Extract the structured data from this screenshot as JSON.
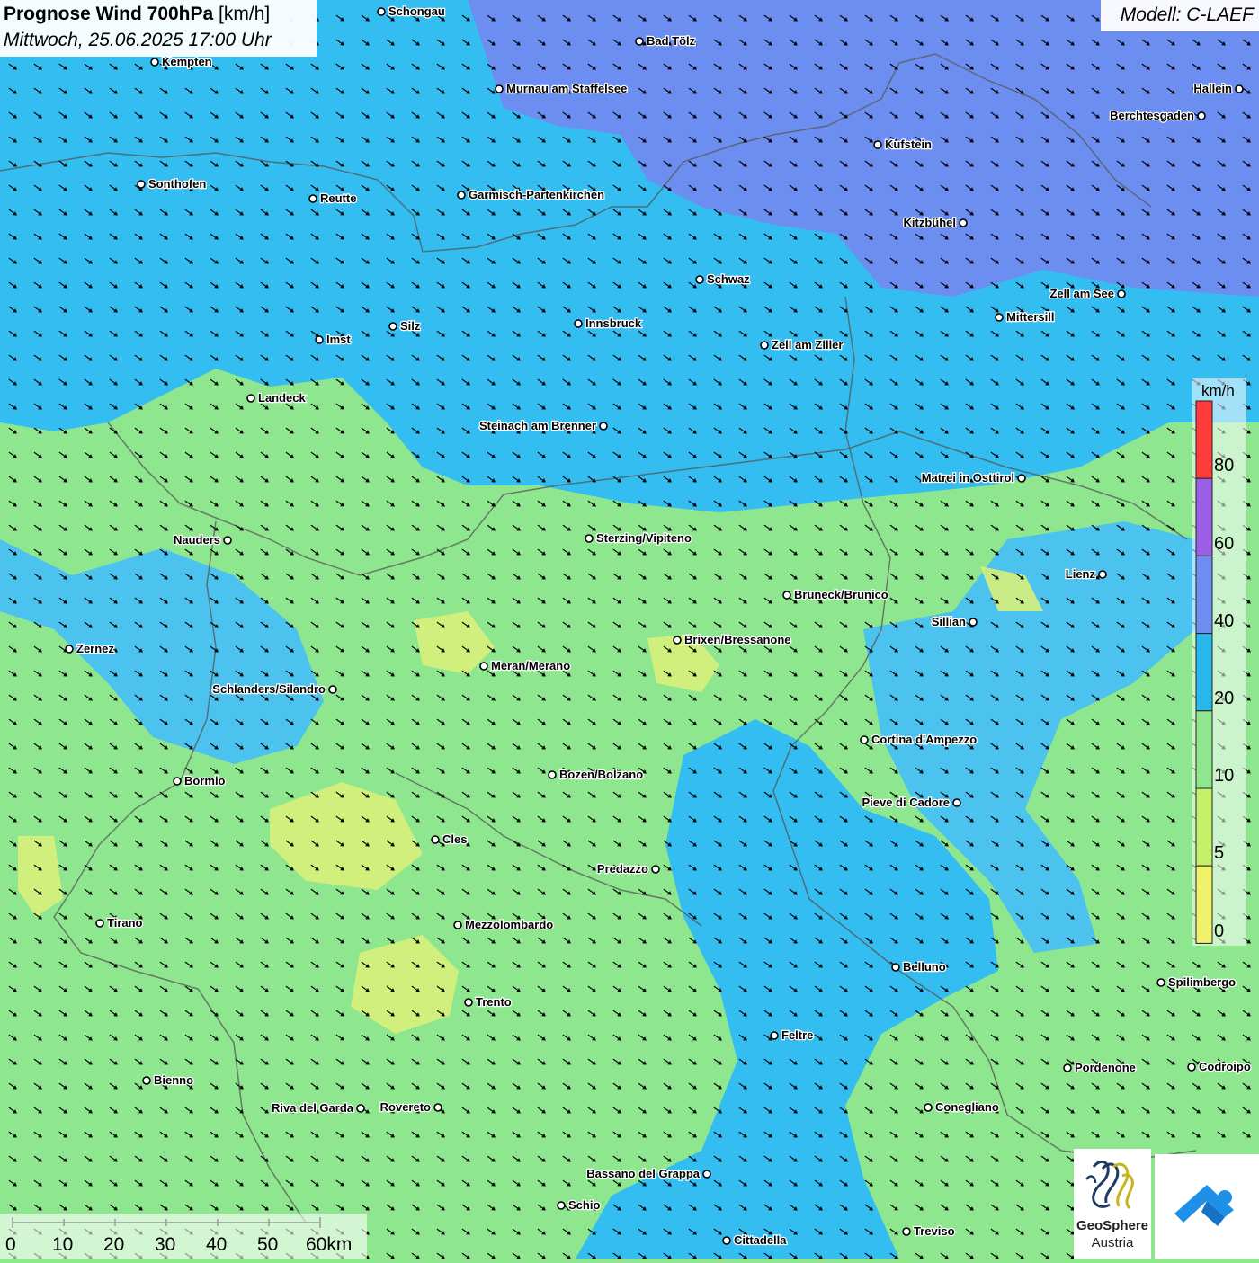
{
  "title": {
    "main": "Prognose Wind 700hPa",
    "unit": "[km/h]",
    "datetime": "Mittwoch, 25.06.2025 17:00 Uhr"
  },
  "model": "Modell: C-LAEF",
  "legend": {
    "unit": "km/h",
    "labels": [
      "80",
      "60",
      "40",
      "20",
      "10",
      "5",
      "0"
    ],
    "colors": [
      "#ff3b3b",
      "#9d5ee6",
      "#6f8cf0",
      "#29b8ec",
      "#8ee68e",
      "#c4f06a",
      "#f2f26a"
    ]
  },
  "scale": {
    "labels": [
      "0",
      "10",
      "20",
      "30",
      "40",
      "50",
      "60km"
    ]
  },
  "cities": [
    {
      "name": "Schongau"
    },
    {
      "name": "Bad Tölz"
    },
    {
      "name": "Kempten"
    },
    {
      "name": "Murnau am Staffelsee"
    },
    {
      "name": "Hallein"
    },
    {
      "name": "Berchtesgaden"
    },
    {
      "name": "Kufstein"
    },
    {
      "name": "Sonthofen"
    },
    {
      "name": "Reutte"
    },
    {
      "name": "Garmisch-Partenkirchen"
    },
    {
      "name": "Kitzbühel"
    },
    {
      "name": "Schwaz"
    },
    {
      "name": "Zell am See"
    },
    {
      "name": "Innsbruck"
    },
    {
      "name": "Mittersill"
    },
    {
      "name": "Silz"
    },
    {
      "name": "Imst"
    },
    {
      "name": "Zell am Ziller"
    },
    {
      "name": "Landeck"
    },
    {
      "name": "Steinach am Brenner"
    },
    {
      "name": "Matrei in Osttirol"
    },
    {
      "name": "Nauders"
    },
    {
      "name": "Sterzing/Vipiteno"
    },
    {
      "name": "Lienz"
    },
    {
      "name": "Bruneck/Brunico"
    },
    {
      "name": "Sillian"
    },
    {
      "name": "Zernez"
    },
    {
      "name": "Brixen/Bressanone"
    },
    {
      "name": "Meran/Merano"
    },
    {
      "name": "Schlanders/Silandro"
    },
    {
      "name": "Cortina d'Ampezzo"
    },
    {
      "name": "Bozen/Bolzano"
    },
    {
      "name": "Bormio"
    },
    {
      "name": "Pieve di Cadore"
    },
    {
      "name": "Cles"
    },
    {
      "name": "Predazzo"
    },
    {
      "name": "Tirano"
    },
    {
      "name": "Mezzolombardo"
    },
    {
      "name": "Belluno"
    },
    {
      "name": "Spilimbergo"
    },
    {
      "name": "Trento"
    },
    {
      "name": "Feltre"
    },
    {
      "name": "Pordenone"
    },
    {
      "name": "Codroipo"
    },
    {
      "name": "Bienno"
    },
    {
      "name": "Riva del Garda"
    },
    {
      "name": "Rovereto"
    },
    {
      "name": "Conegliano"
    },
    {
      "name": "Bassano del Grappa"
    },
    {
      "name": "Schio"
    },
    {
      "name": "Treviso"
    },
    {
      "name": "Cittadella"
    }
  ],
  "logo": {
    "line1": "GeoSphere",
    "line2": "Austria"
  }
}
